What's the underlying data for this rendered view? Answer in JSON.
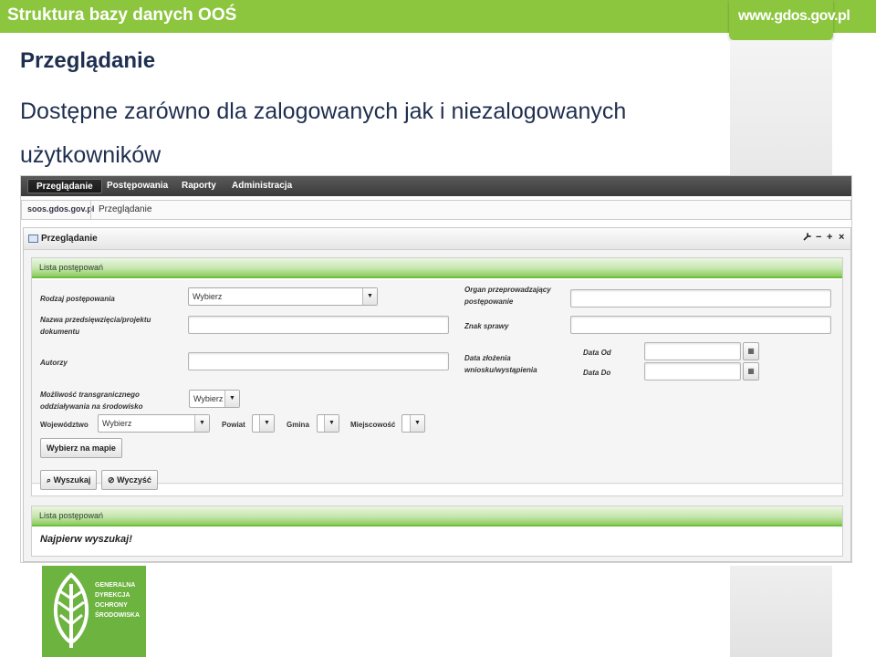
{
  "slide": {
    "header_title": "Struktura bazy danych OOŚ",
    "site_url": "www.gdos.gov.pl",
    "heading": "Przeglądanie",
    "description": "Dostępne zarówno dla zalogowanych jak i niezalogowanych użytkowników",
    "logo_lines": [
      "GENERALNA",
      "DYREKCJA",
      "OCHRONY",
      "ŚRODOWISKA"
    ],
    "colors": {
      "brand_green": "#8cc63f",
      "logo_green": "#6cb33f",
      "heading_text": "#1f2f4f"
    }
  },
  "app": {
    "nav": [
      "Przeglądanie",
      "Postępowania",
      "Raporty",
      "Administracja"
    ],
    "nav_active_index": 0,
    "breadcrumb": {
      "home": "soos.gdos.gov.pl",
      "current": "Przeglądanie"
    },
    "portlet": {
      "title": "Przeglądanie",
      "controls": [
        "wrench-icon",
        "minimize-icon",
        "maximize-icon",
        "close-icon"
      ]
    },
    "search_section": {
      "title": "Lista postępowań",
      "fields": {
        "rodzaj": {
          "label": "Rodzaj postępowania",
          "value": "Wybierz"
        },
        "nazwa": {
          "label": "Nazwa przedsięwzięcia/projektu dokumentu",
          "value": ""
        },
        "autorzy": {
          "label": "Autorzy",
          "value": ""
        },
        "transgraniczne": {
          "label": "Możliwość transgranicznego oddziaływania na środowisko",
          "value": "Wybierz"
        },
        "wojewodztwo": {
          "label": "Województwo",
          "value": "Wybierz"
        },
        "powiat": {
          "label": "Powiat",
          "value": ""
        },
        "gmina": {
          "label": "Gmina",
          "value": ""
        },
        "miejscowosc": {
          "label": "Miejscowość",
          "value": ""
        },
        "organ": {
          "label": "Organ przeprowadzający postępowanie",
          "value": ""
        },
        "znak": {
          "label": "Znak sprawy",
          "value": ""
        },
        "data_zlozenia": {
          "label": "Data złożenia wniosku/wystąpienia"
        },
        "data_od": {
          "label": "Data Od",
          "value": ""
        },
        "data_do": {
          "label": "Data Do",
          "value": ""
        }
      },
      "map_button": "Wybierz na mapie",
      "search_button": "Wyszukaj",
      "clear_button": "Wyczyść"
    },
    "results_section": {
      "title": "Lista postępowań",
      "message": "Najpierw wyszukaj!"
    }
  }
}
